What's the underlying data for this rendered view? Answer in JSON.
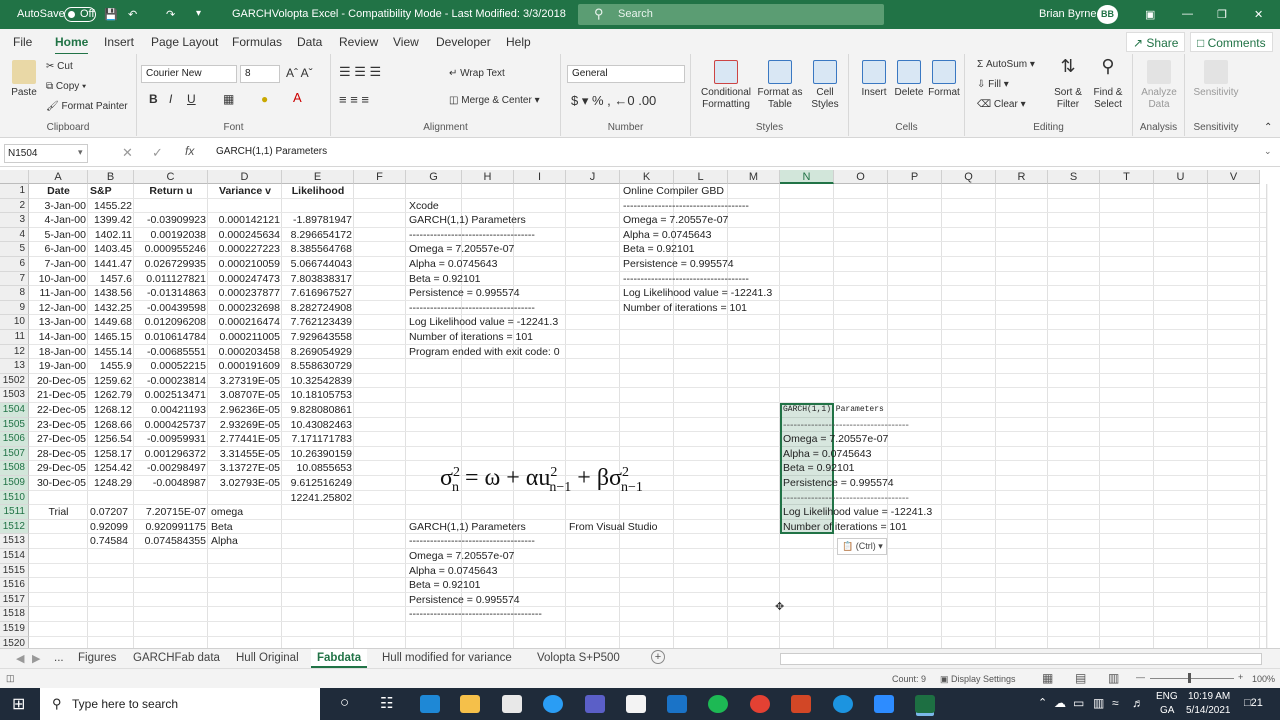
{
  "titlebar": {
    "autosave": "AutoSave",
    "autosave_state": "Off",
    "title": "GARCHVolopta Excel  -  Compatibility Mode  -  Last Modified: 3/3/2018",
    "search": "Search",
    "user": "Brian Byrne",
    "initials": "BB"
  },
  "menu": [
    "File",
    "Home",
    "Insert",
    "Page Layout",
    "Formulas",
    "Data",
    "Review",
    "View",
    "Developer",
    "Help"
  ],
  "menu_actions": {
    "share": "Share",
    "comments": "Comments"
  },
  "ribbon": {
    "clipboard": {
      "paste": "Paste",
      "cut": "Cut",
      "copy": "Copy",
      "format_painter": "Format Painter",
      "label": "Clipboard"
    },
    "font": {
      "name": "Courier New",
      "size": "8",
      "label": "Font"
    },
    "alignment": {
      "wrap": "Wrap Text",
      "merge": "Merge & Center",
      "label": "Alignment"
    },
    "number": {
      "format": "General",
      "label": "Number"
    },
    "styles": {
      "conditional": "Conditional Formatting",
      "format_table": "Format as Table",
      "cell_styles": "Cell Styles",
      "label": "Styles"
    },
    "cells": {
      "insert": "Insert",
      "delete": "Delete",
      "format": "Format",
      "label": "Cells"
    },
    "editing": {
      "autosum": "AutoSum",
      "fill": "Fill",
      "clear": "Clear",
      "sort": "Sort & Filter",
      "find": "Find & Select",
      "label": "Editing"
    },
    "analysis": {
      "analyze": "Analyze Data",
      "label": "Analysis"
    },
    "sensitivity": {
      "sens": "Sensitivity",
      "label": "Sensitivity"
    }
  },
  "formula_bar": {
    "name_box": "N1504",
    "content": "GARCH(1,1) Parameters"
  },
  "columns": [
    "A",
    "B",
    "C",
    "D",
    "E",
    "F",
    "G",
    "H",
    "I",
    "J",
    "K",
    "L",
    "M",
    "N",
    "O",
    "P",
    "Q",
    "R",
    "S",
    "T",
    "U",
    "V"
  ],
  "rows": [
    "1",
    "2",
    "3",
    "4",
    "5",
    "6",
    "7",
    "8",
    "9",
    "10",
    "11",
    "12",
    "13",
    "1502",
    "1503",
    "1504",
    "1505",
    "1506",
    "1507",
    "1508",
    "1509",
    "1510",
    "1511",
    "1512",
    "1513",
    "1514",
    "1515",
    "1516",
    "1517",
    "1518",
    "1519",
    "1520"
  ],
  "headers": {
    "a": "Date",
    "b": "S&P",
    "c": "Return u",
    "d": "Variance v",
    "e": "Likelihood"
  },
  "table": [
    [
      "3-Jan-00",
      "1455.22",
      "",
      "",
      ""
    ],
    [
      "4-Jan-00",
      "1399.42",
      "-0.03909923",
      "0.000142121",
      "-1.89781947"
    ],
    [
      "5-Jan-00",
      "1402.11",
      "0.00192038",
      "0.000245634",
      "8.296654172"
    ],
    [
      "6-Jan-00",
      "1403.45",
      "0.000955246",
      "0.000227223",
      "8.385564768"
    ],
    [
      "7-Jan-00",
      "1441.47",
      "0.026729935",
      "0.000210059",
      "5.066744043"
    ],
    [
      "10-Jan-00",
      "1457.6",
      "0.011127821",
      "0.000247473",
      "7.803838317"
    ],
    [
      "11-Jan-00",
      "1438.56",
      "-0.01314863",
      "0.000237877",
      "7.616967527"
    ],
    [
      "12-Jan-00",
      "1432.25",
      "-0.00439598",
      "0.000232698",
      "8.282724908"
    ],
    [
      "13-Jan-00",
      "1449.68",
      "0.012096208",
      "0.000216474",
      "7.762123439"
    ],
    [
      "14-Jan-00",
      "1465.15",
      "0.010614784",
      "0.000211005",
      "7.929643558"
    ],
    [
      "18-Jan-00",
      "1455.14",
      "-0.00685551",
      "0.000203458",
      "8.269054929"
    ],
    [
      "19-Jan-00",
      "1455.9",
      "0.00052215",
      "0.000191609",
      "8.558630729"
    ],
    [
      "20-Dec-05",
      "1259.62",
      "-0.00023814",
      "3.27319E-05",
      "10.32542839"
    ],
    [
      "21-Dec-05",
      "1262.79",
      "0.002513471",
      "3.08707E-05",
      "10.18105753"
    ],
    [
      "22-Dec-05",
      "1268.12",
      "0.00421193",
      "2.96236E-05",
      "9.828080861"
    ],
    [
      "23-Dec-05",
      "1268.66",
      "0.000425737",
      "2.93269E-05",
      "10.43082463"
    ],
    [
      "27-Dec-05",
      "1256.54",
      "-0.00959931",
      "2.77441E-05",
      "7.171171783"
    ],
    [
      "28-Dec-05",
      "1258.17",
      "0.001296372",
      "3.31455E-05",
      "10.26390159"
    ],
    [
      "29-Dec-05",
      "1254.42",
      "-0.00298497",
      "3.13727E-05",
      "10.0855653"
    ],
    [
      "30-Dec-05",
      "1248.29",
      "-0.0048987",
      "3.02793E-05",
      "9.612516249"
    ]
  ],
  "sum_likelihood": "12241.25802",
  "trial": {
    "label": "Trial",
    "rows": [
      [
        "0.07207",
        "7.20715E-07",
        "omega"
      ],
      [
        "0.92099",
        "0.920991175",
        "Beta"
      ],
      [
        "0.74584",
        "0.074584355",
        "Alpha"
      ]
    ]
  },
  "xcode": [
    "Xcode",
    "GARCH(1,1) Parameters",
    "------------------------------------",
    "Omega        = 7.20557e-07",
    "Alpha        = 0.0745643",
    "Beta          = 0.92101",
    "Persistence = 0.995574",
    "------------------------------------",
    "Log Likelihood value = -12241.3",
    "Number of iterations = 101",
    "Program ended with exit code: 0"
  ],
  "online": [
    "Online Compiler GBD",
    "------------------------------------",
    "Omega        = 7.20557e-07",
    "Alpha        = 0.0745643",
    "Beta          = 0.92101",
    "Persistence = 0.995574",
    "------------------------------------",
    "Log Likelihood value = -12241.3",
    "Number of iterations = 101"
  ],
  "vs_title": "From Visual Studio",
  "vs": [
    "GARCH(1,1) Parameters",
    "------------------------------------",
    "Omega        = 7.20557e-07",
    "Alpha        = 0.0745643",
    "Beta          = 0.92101",
    "Persistence = 0.995574",
    "--------------------------------------"
  ],
  "pasted": {
    "head": "GARCH(1,1) Parameters",
    "lines": [
      "Omega        = 7.20557e-07",
      "Alpha        = 0.0745643",
      "Beta          = 0.92101",
      "Persistence = 0.995574",
      "Log Likelihood value = -12241.3",
      "Number of iterations = 101"
    ],
    "ctrl": "(Ctrl)"
  },
  "sheets": [
    "...",
    "Figures",
    "GARCHFab data",
    "Hull Original",
    "Fabdata",
    "Hull modified for variance",
    "Volopta S+P500"
  ],
  "status": {
    "count": "Count: 9",
    "display": "Display Settings",
    "zoom": "100%"
  },
  "taskbar": {
    "search": "Type here to search",
    "lang": "ENG",
    "lang2": "GA",
    "time": "10:19 AM",
    "date": "5/14/2021",
    "notif": "21"
  }
}
